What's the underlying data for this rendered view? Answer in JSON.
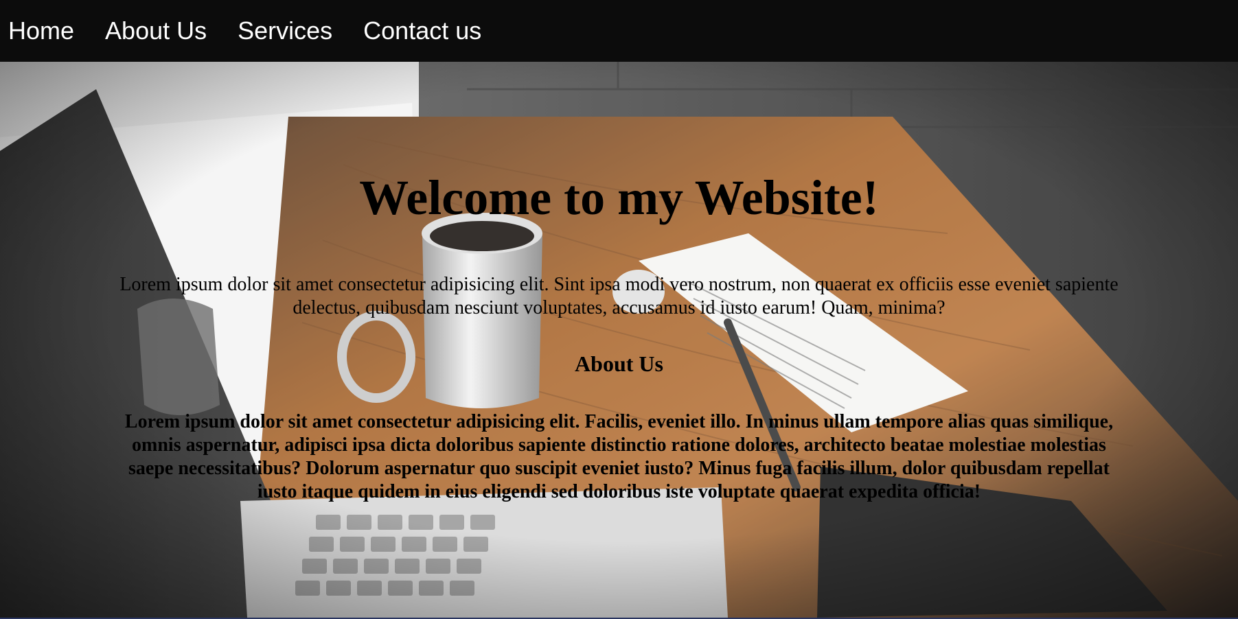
{
  "nav": {
    "items": [
      {
        "label": "Home"
      },
      {
        "label": "About Us"
      },
      {
        "label": "Services"
      },
      {
        "label": "Contact us"
      }
    ]
  },
  "hero": {
    "title": "Welcome to my Website!",
    "intro": "Lorem ipsum dolor sit amet consectetur adipisicing elit. Sint ipsa modi vero nostrum, non quaerat ex officiis esse eveniet sapiente delectus, quibusdam nesciunt voluptates, accusamus id iusto earum! Quam, minima?"
  },
  "about": {
    "heading": "About Us",
    "body": "Lorem ipsum dolor sit amet consectetur adipisicing elit. Facilis, eveniet illo. In minus ullam tempore alias quas similique, omnis aspernatur, adipisci ipsa dicta doloribus sapiente distinctio ratione dolores, architecto beatae molestiae molestias saepe necessitatibus? Dolorum aspernatur quo suscipit eveniet iusto? Minus fuga facilis illum, dolor quibusdam repellat iusto itaque quidem in eius eligendi sed doloribus iste voluptate quaerat expedita officia!"
  },
  "colors": {
    "navbar_bg": "#0c0c0c",
    "nav_text": "#ffffff",
    "text": "#000000",
    "table_wood": "#a5612a"
  }
}
